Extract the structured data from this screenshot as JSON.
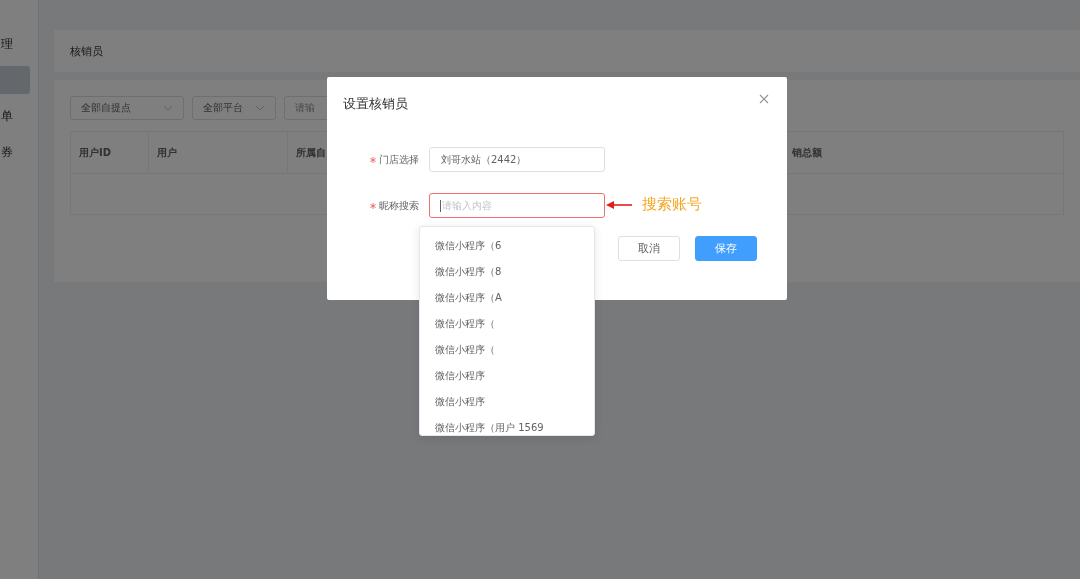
{
  "sidebar": {
    "items": [
      {
        "label": "理",
        "selected": false
      },
      {
        "selected": true
      },
      {
        "label": "单",
        "selected": false
      },
      {
        "label": "券",
        "selected": false
      }
    ]
  },
  "page": {
    "title": "核销员",
    "filters": [
      {
        "kind": "select",
        "value": "全部自提点"
      },
      {
        "kind": "select",
        "value": "全部平台"
      },
      {
        "kind": "input",
        "placeholder": "请输"
      }
    ],
    "table": {
      "columns": [
        "用户ID",
        "用户",
        "所属自"
      ],
      "column_5": "销总额"
    }
  },
  "dialog": {
    "title": "设置核销员",
    "fields": [
      {
        "label": "门店选择",
        "required": true,
        "kind": "value",
        "value": "刘哥水站（2442）",
        "invalid": false
      },
      {
        "label": "昵称搜索",
        "required": true,
        "kind": "placeholder",
        "placeholder": "请输入内容",
        "invalid": true
      }
    ],
    "buttons": [
      {
        "label": "取消",
        "primary": false
      },
      {
        "label": "保存",
        "primary": true
      }
    ]
  },
  "dropdown": {
    "items": [
      "微信小程序（6",
      "微信小程序（8",
      "微信小程序（A",
      "微信小程序（",
      "微信小程序（",
      "微信小程序",
      "微信小程序",
      "微信小程序（用户 1569"
    ]
  },
  "annotation": {
    "text": "搜索账号"
  }
}
